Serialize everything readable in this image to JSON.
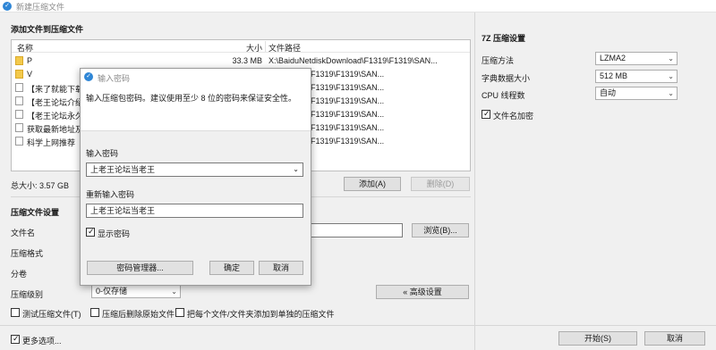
{
  "window": {
    "title": "新建压缩文件"
  },
  "files_section": {
    "title": "添加文件到压缩文件",
    "columns": {
      "name": "名称",
      "size": "大小",
      "path": "文件路径"
    },
    "rows": [
      {
        "type": "folder",
        "name": "P",
        "size": "33.3 MB",
        "path": "X:\\BaiduNetdiskDownload\\F1319\\F1319\\SAN..."
      },
      {
        "type": "folder",
        "name": "V",
        "size": "",
        "path": "kDownload\\F1319\\F1319\\SAN..."
      },
      {
        "type": "file",
        "name": "【来了就能下载到",
        "size": "",
        "path": "kDownload\\F1319\\F1319\\SAN..."
      },
      {
        "type": "file",
        "name": "【老王论坛介绍】",
        "size": "",
        "path": "kDownload\\F1319\\F1319\\SAN..."
      },
      {
        "type": "file",
        "name": "【老王论坛永久域",
        "size": "",
        "path": "kDownload\\F1319\\F1319\\SAN..."
      },
      {
        "type": "file",
        "name": "获取最新地址及A",
        "size": "",
        "path": "kDownload\\F1319\\F1319\\SAN..."
      },
      {
        "type": "file",
        "name": "科学上网推荐（U",
        "size": "",
        "path": "kDownload\\F1319\\F1319\\SAN..."
      }
    ],
    "total_size": "总大小: 3.57 GB",
    "add_button": "添加(A)",
    "delete_button": "删除(D)"
  },
  "compress_settings": {
    "title": "压缩文件设置",
    "filename_label": "文件名",
    "browse_button": "浏览(B)...",
    "format_label": "压缩格式",
    "volume_label": "分卷",
    "level_label": "压缩级别",
    "level_value": "0-仅存储",
    "advanced_button": "« 高级设置",
    "test_label": "测试压缩文件(T)",
    "delete_after_label": "压缩后删除原始文件",
    "separate_label": "把每个文件/文件夹添加到单独的压缩文件"
  },
  "sevenzip": {
    "title": "7Z 压缩设置",
    "method_label": "压缩方法",
    "method_value": "LZMA2",
    "dict_label": "字典数据大小",
    "dict_value": "512 MB",
    "cpu_label": "CPU 线程数",
    "cpu_value": "自动",
    "encrypt_label": "文件名加密"
  },
  "footer": {
    "more_options": "更多选项...",
    "start_button": "开始(S)",
    "cancel_button": "取消"
  },
  "password_dialog": {
    "title": "输入密码",
    "description": "输入压缩包密码。建议使用至少 8 位的密码来保证安全性。",
    "password_label": "输入密码",
    "password_value": "上老王论坛当老王",
    "repeat_label": "重新输入密码",
    "repeat_value": "上老王论坛当老王",
    "show_password_label": "显示密码",
    "manager_button": "密码管理器...",
    "ok_button": "确定",
    "cancel_button": "取消"
  }
}
